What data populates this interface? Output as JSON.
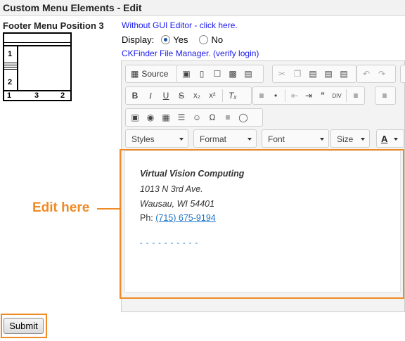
{
  "page": {
    "title": "Custom Menu Elements - Edit"
  },
  "position": {
    "label": "Footer Menu Position 3",
    "diagram_numbers": [
      "1",
      "2",
      "1",
      "3",
      "2"
    ]
  },
  "links": {
    "no_gui": "Without GUI Editor - click here.",
    "ckfinder": "CKFinder File Manager. (verify login)"
  },
  "display": {
    "label": "Display:",
    "yes": "Yes",
    "no": "No",
    "selected": "Yes"
  },
  "toolbar": {
    "source_label": "Source",
    "combos": {
      "styles": "Styles",
      "format": "Format",
      "font": "Font",
      "size": "Size"
    },
    "text_color_letter": "A"
  },
  "content": {
    "company": "Virtual Vision Computing",
    "street": "1013 N 3rd Ave.",
    "city": "Wausau, WI 54401",
    "phone_prefix": "Ph: ",
    "phone": "(715) 675-9194",
    "dashes": "- - - - - - - - - -"
  },
  "annotation": {
    "edit_here": "Edit here",
    "color": "#f08a24"
  },
  "submit": {
    "label": "Submit"
  }
}
